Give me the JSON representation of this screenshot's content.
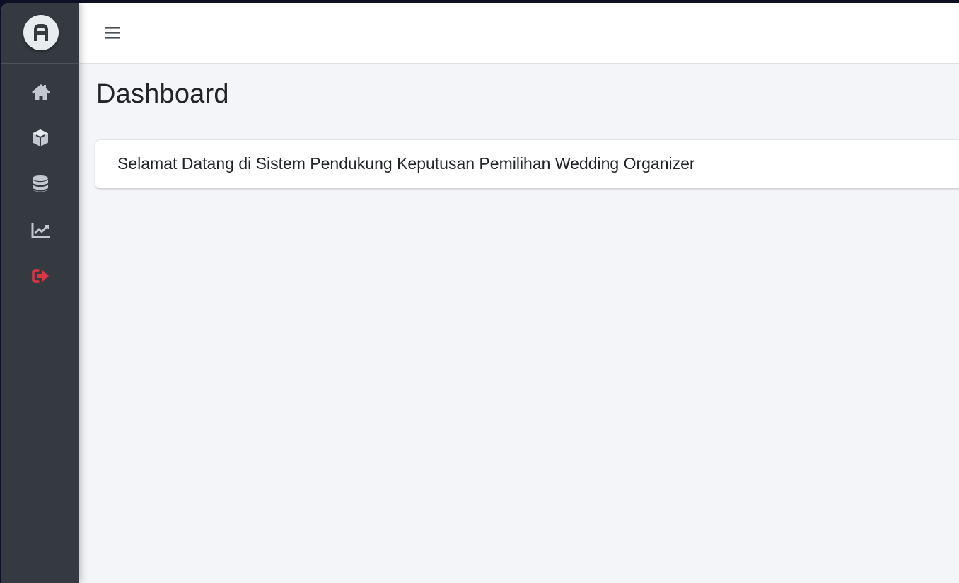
{
  "brand": {
    "logo_icon": "letter-a-logo"
  },
  "sidebar": {
    "items": [
      {
        "icon": "home-icon",
        "color": "#c2c7d0"
      },
      {
        "icon": "cube-icon",
        "color": "#c2c7d0"
      },
      {
        "icon": "database-icon",
        "color": "#c2c7d0"
      },
      {
        "icon": "chart-line-icon",
        "color": "#c2c7d0"
      },
      {
        "icon": "sign-out-icon",
        "color": "#dc3545"
      }
    ]
  },
  "topbar": {
    "menu_icon": "hamburger-menu-icon"
  },
  "main": {
    "page_title": "Dashboard",
    "welcome_text": "Selamat Datang di Sistem Pendukung Keputusan Pemilihan Wedding Organizer"
  },
  "colors": {
    "sidebar_bg": "#343a40",
    "content_bg": "#f4f5f8",
    "topbar_bg": "#ffffff",
    "danger": "#dc3545"
  }
}
